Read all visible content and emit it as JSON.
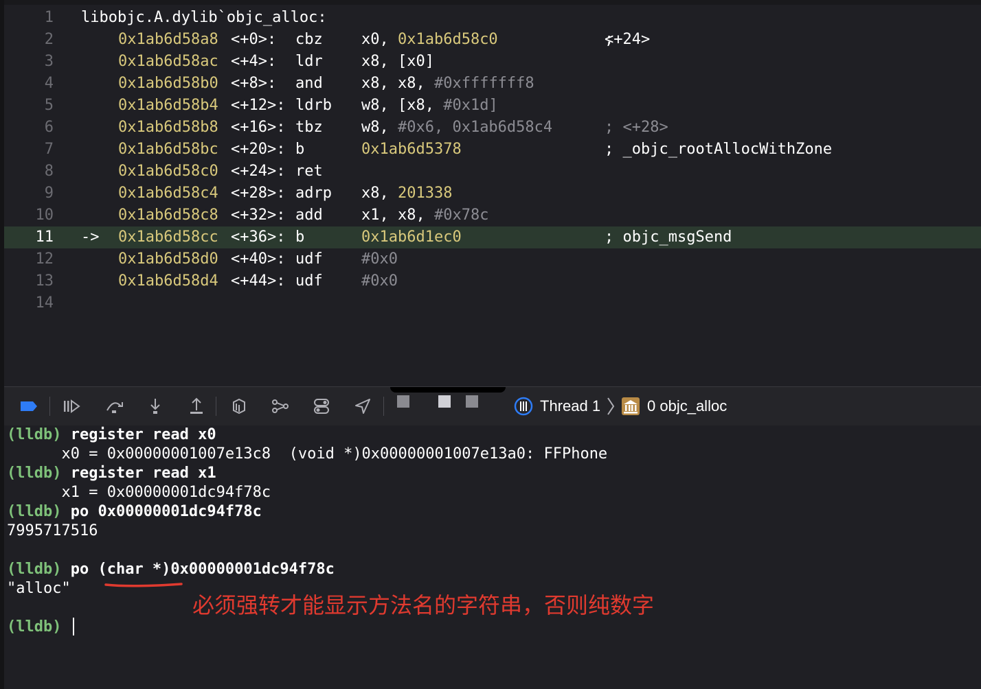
{
  "disassembly": {
    "header": {
      "line": "1",
      "text": "libobjc.A.dylib`objc_alloc:"
    },
    "rows": [
      {
        "line": "2",
        "addr": "0x1ab6d58a8",
        "offset": "<+0>:",
        "op": "cbz",
        "a1": "x0, ",
        "a2": "0x1ab6d58c0",
        "a3": "",
        "c1": "; ",
        "c2": "<+24>"
      },
      {
        "line": "3",
        "addr": "0x1ab6d58ac",
        "offset": "<+4>:",
        "op": "ldr",
        "a1": "x8, [x0]",
        "a2": "",
        "a3": "",
        "c1": "",
        "c2": ""
      },
      {
        "line": "4",
        "addr": "0x1ab6d58b0",
        "offset": "<+8>:",
        "op": "and",
        "a1": "x8, x8, ",
        "a2": "",
        "a3": "#0xfffffff8",
        "c1": "",
        "c2": ""
      },
      {
        "line": "5",
        "addr": "0x1ab6d58b4",
        "offset": "<+12>:",
        "op": "ldrb",
        "a1": "w8, [x8, ",
        "a2": "",
        "a3": "#0x1d]",
        "c1": "",
        "c2": ""
      },
      {
        "line": "6",
        "addr": "0x1ab6d58b8",
        "offset": "<+16>:",
        "op": "tbz",
        "a1": "w8, ",
        "a2": "",
        "a3": "#0x6, 0x1ab6d58c4",
        "c1": "",
        "c2": "; <+28>"
      },
      {
        "line": "7",
        "addr": "0x1ab6d58bc",
        "offset": "<+20>:",
        "op": "b",
        "a1": "",
        "a2": "0x1ab6d5378",
        "a3": "",
        "c1": "; _objc_rootAllocWithZone",
        "c2": ""
      },
      {
        "line": "8",
        "addr": "0x1ab6d58c0",
        "offset": "<+24>:",
        "op": "ret",
        "a1": "",
        "a2": "",
        "a3": "",
        "c1": "",
        "c2": ""
      },
      {
        "line": "9",
        "addr": "0x1ab6d58c4",
        "offset": "<+28>:",
        "op": "adrp",
        "a1": "x8, ",
        "a2": "201338",
        "a3": "",
        "c1": "",
        "c2": ""
      },
      {
        "line": "10",
        "addr": "0x1ab6d58c8",
        "offset": "<+32>:",
        "op": "add",
        "a1": "x1, x8, ",
        "a2": "",
        "a3": "#0x78c",
        "c1": "",
        "c2": ""
      },
      {
        "line": "11",
        "arrow": "->",
        "addr": "0x1ab6d58cc",
        "offset": "<+36>:",
        "op": "b",
        "a1": "",
        "a2": "0x1ab6d1ec0",
        "a3": "",
        "c1": "; objc_msgSend",
        "c2": ""
      },
      {
        "line": "12",
        "addr": "0x1ab6d58d0",
        "offset": "<+40>:",
        "op": "udf",
        "a1": "",
        "a2": "",
        "a3": "#0x0",
        "c1": "",
        "c2": ""
      },
      {
        "line": "13",
        "addr": "0x1ab6d58d4",
        "offset": "<+44>:",
        "op": "udf",
        "a1": "",
        "a2": "",
        "a3": "#0x0",
        "c1": "",
        "c2": ""
      }
    ],
    "last_line": "14"
  },
  "toolbar": {
    "thread_label": "Thread 1",
    "frame_label": "0 objc_alloc",
    "icons": [
      "breakpoints-toggle-icon",
      "continue-icon",
      "step-over-icon",
      "step-into-icon",
      "step-out-icon",
      "view-hierarchy-icon",
      "memory-graph-icon",
      "environment-overrides-icon",
      "simulate-location-icon",
      "thread-icon",
      "frame-icon"
    ],
    "accent": "#2e7cf6"
  },
  "console": {
    "prompt": "(lldb)",
    "lines": [
      {
        "kind": "cmd",
        "text": " register read x0"
      },
      {
        "kind": "out",
        "text": "      x0 = 0x00000001007e13c8  (void *)0x00000001007e13a0: FFPhone"
      },
      {
        "kind": "cmd",
        "text": " register read x1"
      },
      {
        "kind": "out",
        "text": "      x1 = 0x00000001dc94f78c"
      },
      {
        "kind": "cmd",
        "text": " po 0x00000001dc94f78c"
      },
      {
        "kind": "out",
        "text": "7995717516"
      },
      {
        "kind": "cmd",
        "text": " po (char *)0x00000001dc94f78c"
      },
      {
        "kind": "out",
        "text": "\"alloc\""
      },
      {
        "kind": "cmd",
        "text": " "
      }
    ],
    "annotation": "必须强转才能显示方法名的字符串，否则纯数字",
    "annotation_color": "#e03a2f",
    "prompt_color": "#7fc27a"
  }
}
